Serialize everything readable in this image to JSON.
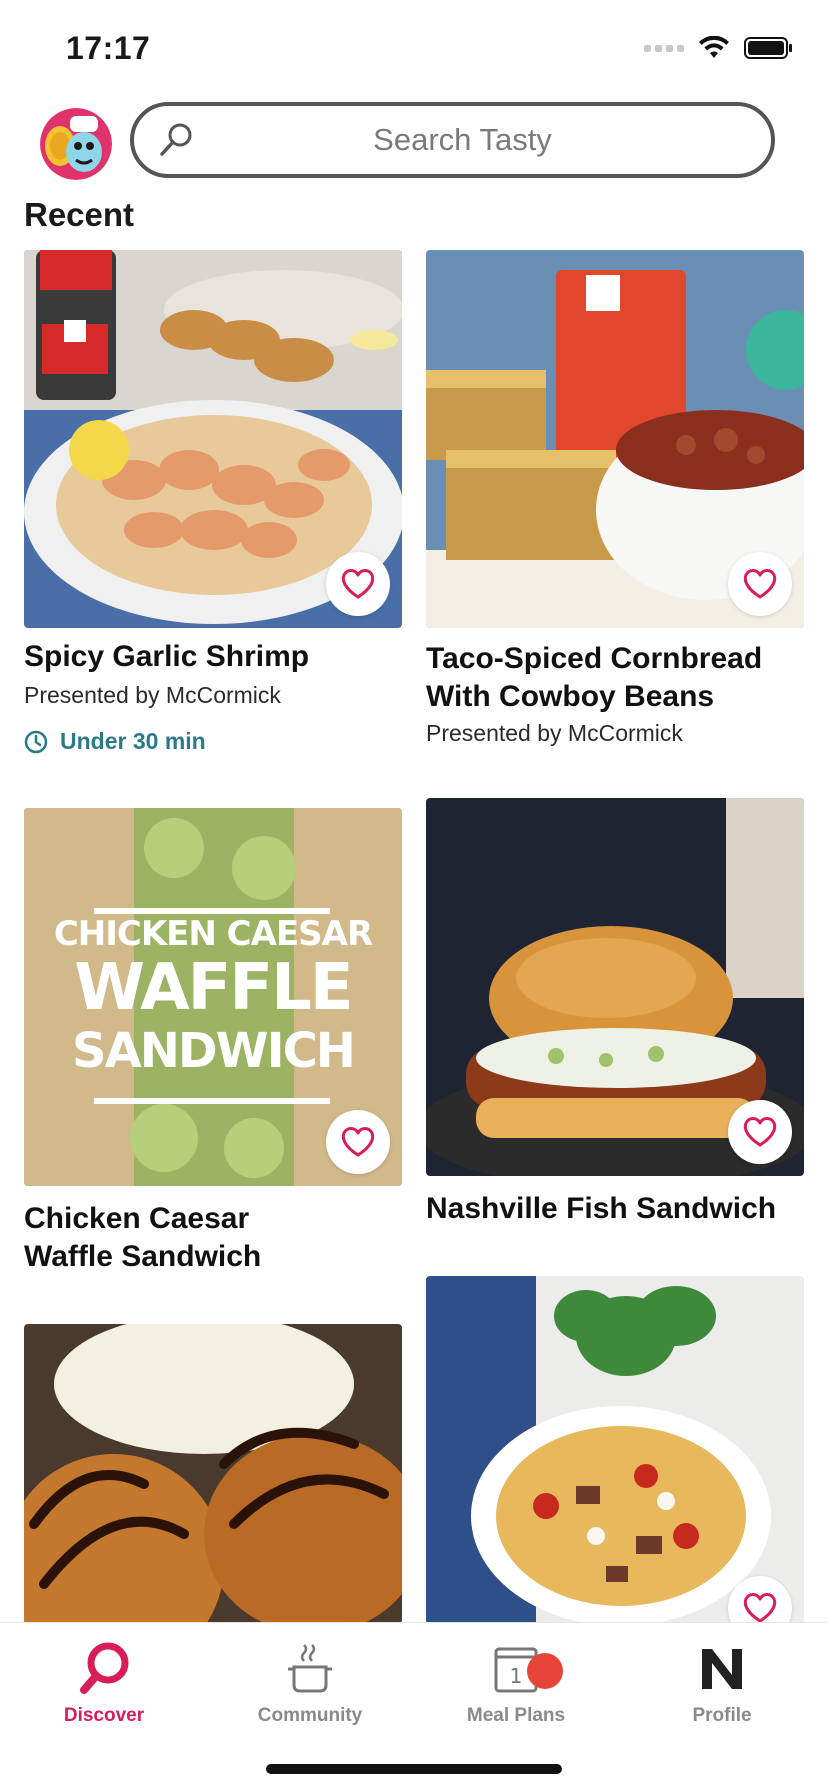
{
  "status": {
    "time": "17:17"
  },
  "search": {
    "placeholder": "Search Tasty"
  },
  "section": {
    "title": "Recent"
  },
  "cards": [
    {
      "title": "Spicy Garlic Shrimp",
      "presenter": "Presented by McCormick",
      "time": "Under 30 min"
    },
    {
      "title_line1": "Taco-Spiced Cornbread",
      "title_line2": "With Cowboy Beans",
      "presenter": "Presented by McCormick"
    },
    {
      "title_line1": "Chicken Caesar",
      "title_line2": "Waffle Sandwich",
      "image_text_1": "CHICKEN CAESAR",
      "image_text_2": "WAFFLE",
      "image_text_3": "SANDWICH"
    },
    {
      "title": "Nashville Fish Sandwich"
    }
  ],
  "tabs": [
    {
      "label": "Discover",
      "icon": "discover-icon",
      "active": true
    },
    {
      "label": "Community",
      "icon": "pot-icon"
    },
    {
      "label": "Meal Plans",
      "icon": "calendar-icon",
      "calendar_day": "1"
    },
    {
      "label": "Profile",
      "icon": "profile-n-icon"
    }
  ],
  "colors": {
    "accent": "#d81d57",
    "time_teal": "#2a7a8c",
    "badge": "#e8443a"
  }
}
